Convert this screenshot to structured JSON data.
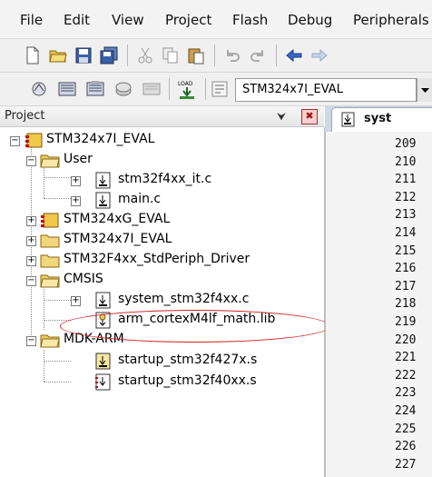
{
  "menu": [
    "File",
    "Edit",
    "View",
    "Project",
    "Flash",
    "Debug",
    "Peripherals"
  ],
  "toolbar2": {
    "load_icon_text": "LOAD",
    "target_value": "STM324x7I_EVAL"
  },
  "project_panel": {
    "title": "Project",
    "pin_glyph": "⮟",
    "close_glyph": "✖"
  },
  "tree": {
    "root": "STM324x7I_EVAL",
    "user": "User",
    "file_it": "stm32f4xx_it.c",
    "file_main": "main.c",
    "g_eval": "STM324xG_EVAL",
    "i_eval": "STM324x7I_EVAL",
    "driver": "STM32F4xx_StdPeriph_Driver",
    "cmsis": "CMSIS",
    "system": "system_stm32f4xx.c",
    "mathlib": "arm_cortexM4lf_math.lib",
    "mdk": "MDK-ARM",
    "startup427": "startup_stm32f427x.s",
    "startup40": "startup_stm32f40xx.s"
  },
  "editor": {
    "tab_label": "syst",
    "line_numbers": [
      "209",
      "210",
      "211",
      "212",
      "213",
      "214",
      "215",
      "216",
      "217",
      "218",
      "219",
      "220",
      "221",
      "222",
      "223",
      "224",
      "225",
      "226",
      "227"
    ]
  },
  "colors": {
    "highlight_ellipse": "#d02020",
    "folder_yellow": "#f2d77a"
  }
}
